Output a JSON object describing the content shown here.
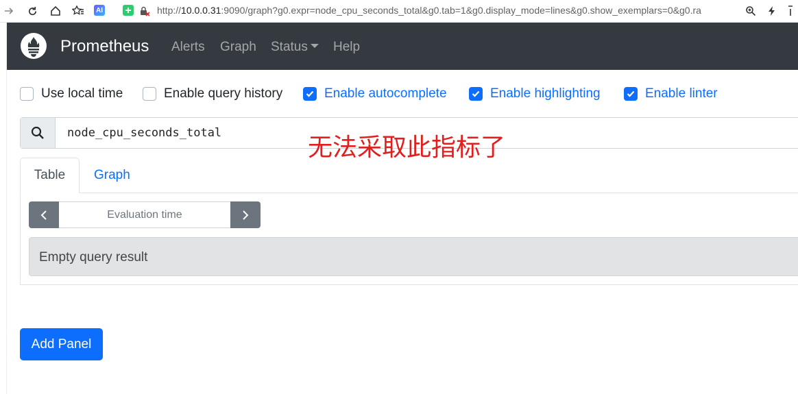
{
  "browser": {
    "url_prefix": "http://",
    "url_host": "10.0.0.31",
    "url_rest": ":9090/graph?g0.expr=node_cpu_seconds_total&g0.tab=1&g0.display_mode=lines&g0.show_exemplars=0&g0.ra",
    "ai_badge": "AI"
  },
  "navbar": {
    "brand": "Prometheus",
    "links": [
      "Alerts",
      "Graph",
      "Status",
      "Help"
    ]
  },
  "options": [
    {
      "label": "Use local time",
      "checked": false
    },
    {
      "label": "Enable query history",
      "checked": false
    },
    {
      "label": "Enable autocomplete",
      "checked": true
    },
    {
      "label": "Enable highlighting",
      "checked": true
    },
    {
      "label": "Enable linter",
      "checked": true
    }
  ],
  "query": {
    "expression": "node_cpu_seconds_total",
    "annotation": "无法采取此指标了"
  },
  "panel": {
    "tabs": [
      "Table",
      "Graph"
    ],
    "eval_placeholder": "Evaluation time",
    "result": "Empty query result"
  },
  "add_panel_label": "Add Panel",
  "colors": {
    "navbar": "#343a40",
    "primary": "#0d6efd",
    "annotation": "#e0201e"
  }
}
